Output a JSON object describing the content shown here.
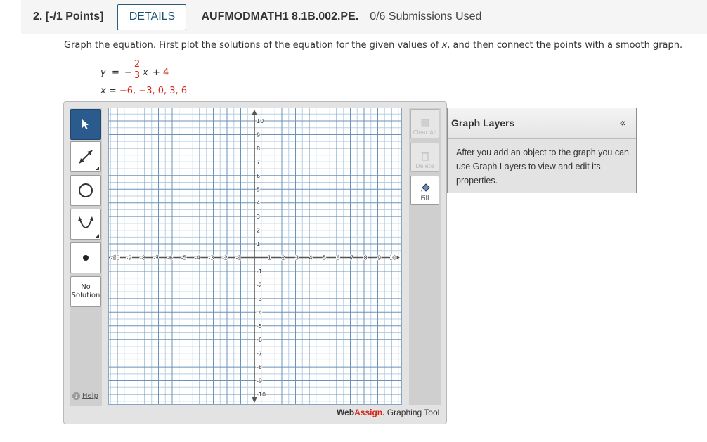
{
  "header": {
    "question_number": "2. [-/1 Points]",
    "details_label": "DETAILS",
    "assignment_code": "AUFMODMATH1 8.1B.002.PE.",
    "submissions": "0/6 Submissions Used"
  },
  "question": {
    "instruction_part1": "Graph the equation. First plot the solutions of the equation for the given values of ",
    "instruction_var": "x",
    "instruction_part2": ", and then connect the points with a smooth graph.",
    "equation": {
      "lhs": "y",
      "equals": "=",
      "sign": "−",
      "numerator": "2",
      "denominator": "3",
      "var": "x",
      "plus": "+",
      "constant": "4"
    },
    "values_line": {
      "var": "x",
      "equals": "=",
      "values": "−6, −3, 0, 3, 6"
    }
  },
  "graph_tool": {
    "tools": [
      "pointer",
      "line",
      "circle",
      "parabola",
      "point"
    ],
    "no_solution_line1": "No",
    "no_solution_line2": "Solution",
    "help_label": "Help",
    "clear_all_label": "Clear All",
    "delete_label": "Delete",
    "fill_label": "Fill",
    "brand_web": "Web",
    "brand_assign": "Assign.",
    "brand_suffix": " Graphing Tool",
    "axis": {
      "xmin": -10,
      "xmax": 10,
      "ymin": -10,
      "ymax": 10,
      "minor_step": 0.5,
      "major_step": 1,
      "x_tick_labels": [
        "-10",
        "-9",
        "-8",
        "-7",
        "-6",
        "-5",
        "-4",
        "-3",
        "-2",
        "-1",
        "1",
        "2",
        "3",
        "4",
        "5",
        "6",
        "7",
        "8",
        "9",
        "10"
      ],
      "y_tick_labels": [
        "10",
        "9",
        "8",
        "7",
        "6",
        "5",
        "4",
        "3",
        "2",
        "1",
        "-1",
        "-2",
        "-3",
        "-4",
        "-5",
        "-6",
        "-7",
        "-8",
        "-9",
        "-10"
      ]
    },
    "colors": {
      "minor_grid": "#b9cfe3",
      "major_grid": "#6b92b8",
      "axis": "#555555",
      "active_tool": "#2b5a8d",
      "accent_red": "#d4271c"
    }
  },
  "layers_panel": {
    "title": "Graph Layers",
    "collapse": "«",
    "body": "After you add an object to the graph you can use Graph Layers to view and edit its properties."
  }
}
